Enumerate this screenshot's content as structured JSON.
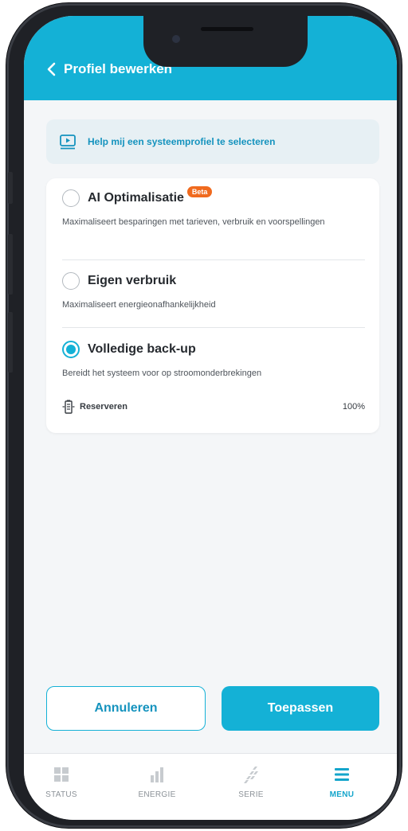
{
  "header": {
    "back_label": "Profiel bewerken"
  },
  "help_banner": {
    "label": "Help mij een systeemprofiel te selecteren",
    "icon": "play-video-icon"
  },
  "options": [
    {
      "title": "AI Optimalisatie",
      "badge": "Beta",
      "description": "Maximaliseert besparingen met tarieven, verbruik en voorspellingen",
      "selected": false
    },
    {
      "title": "Eigen verbruik",
      "description": "Maximaliseert energieonafhankelijkheid",
      "selected": false
    },
    {
      "title": "Volledige back-up",
      "description": "Bereidt het systeem voor op stroomonderbrekingen",
      "selected": true
    }
  ],
  "reserve": {
    "label": "Reserveren",
    "value": "100%"
  },
  "buttons": {
    "cancel": "Annuleren",
    "apply": "Toepassen"
  },
  "tabs": [
    {
      "label": "STATUS",
      "icon": "grid-icon",
      "active": false
    },
    {
      "label": "ENERGIE",
      "icon": "bar-chart-icon",
      "active": false
    },
    {
      "label": "SERIE",
      "icon": "solar-panel-icon",
      "active": false
    },
    {
      "label": "MENU",
      "icon": "hamburger-menu-icon",
      "active": true
    }
  ],
  "colors": {
    "accent": "#14b1d6",
    "beta_badge": "#f06a1e"
  }
}
